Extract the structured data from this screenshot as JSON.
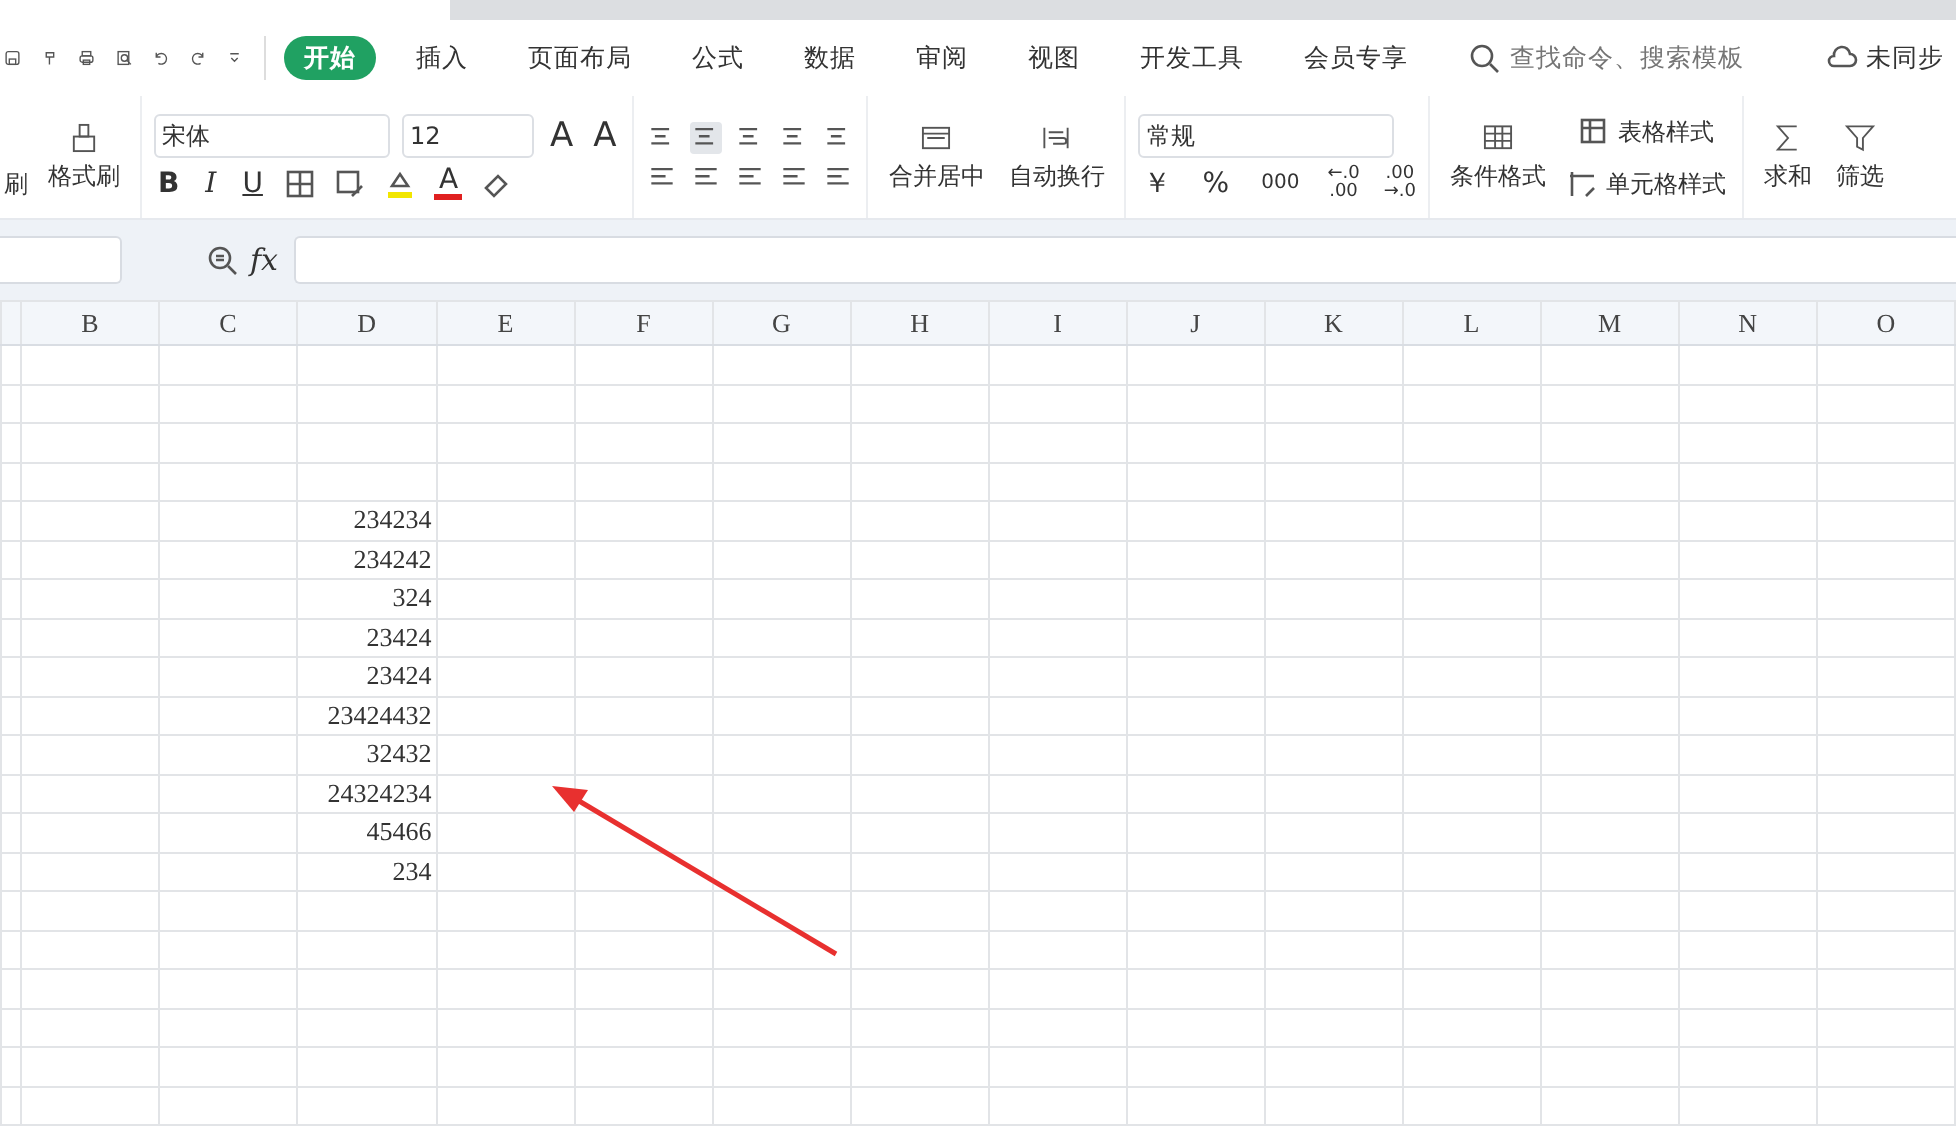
{
  "tabs": [
    {
      "label": "开始",
      "selected": true
    },
    {
      "label": "插入",
      "selected": false
    },
    {
      "label": "页面布局",
      "selected": false
    },
    {
      "label": "公式",
      "selected": false
    },
    {
      "label": "数据",
      "selected": false
    },
    {
      "label": "审阅",
      "selected": false
    },
    {
      "label": "视图",
      "selected": false
    },
    {
      "label": "开发工具",
      "selected": false
    },
    {
      "label": "会员专享",
      "selected": false
    }
  ],
  "search": {
    "placeholder": "查找命令、搜索模板"
  },
  "sync_status": "未同步",
  "ribbon": {
    "cut_label": "刷",
    "format_painter": "格式刷",
    "font_name": "宋体",
    "font_size": "12",
    "grow_font": "A",
    "shrink_font": "A",
    "bold": "B",
    "italic": "I",
    "underline": "U",
    "font_color": "A",
    "merge": "合并居中",
    "wrap": "自动换行",
    "number_format": "常规",
    "currency": "￥",
    "percent": "%",
    "thousands": "000",
    "increase_decimal": [
      "←.0",
      ".00"
    ],
    "decrease_decimal": [
      ".00",
      "→.0"
    ],
    "conditional_format": "条件格式",
    "table_style": "表格样式",
    "cell_style": "单元格样式",
    "sum": "求和",
    "filter": "筛选"
  },
  "formula_bar": {
    "fx": "fx"
  },
  "table": {
    "columns": [
      "B",
      "C",
      "D",
      "E",
      "F",
      "G",
      "H",
      "I",
      "J",
      "K",
      "L",
      "M",
      "N",
      "O"
    ],
    "rows": [
      {},
      {},
      {},
      {},
      {
        "D": "234234"
      },
      {
        "D": "234242"
      },
      {
        "D": "324"
      },
      {
        "D": "23424"
      },
      {
        "D": "23424"
      },
      {
        "D": "23424432"
      },
      {
        "D": "32432"
      },
      {
        "D": "24324234"
      },
      {
        "D": "45466"
      },
      {
        "D": "234"
      },
      {},
      {},
      {},
      {},
      {},
      {}
    ]
  }
}
